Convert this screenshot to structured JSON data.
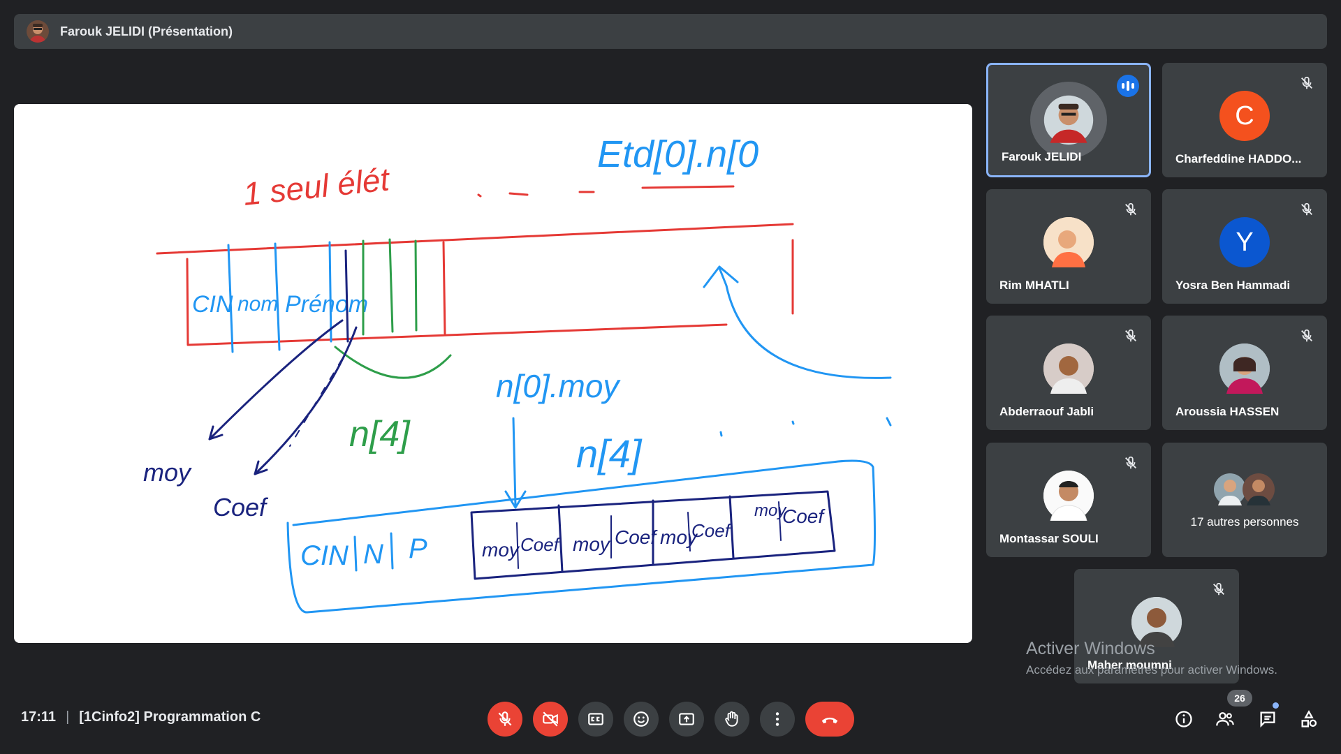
{
  "presenter_bar": {
    "title": "Farouk JELIDI (Présentation)"
  },
  "whiteboard": {
    "texts": [
      "1 seul élét",
      "Etd[0].n[0",
      "CIN",
      "nom",
      "Prénom",
      "n[0].moy",
      "n[4]",
      "n[4]",
      "moy",
      "Coef",
      "CIN",
      "N",
      "P",
      "moy",
      "Coef",
      "moy",
      "Coef",
      "moy",
      "Coef",
      "moy",
      "Coef"
    ]
  },
  "participants": [
    {
      "name": "Farouk JELIDI",
      "avatar": "photo-farouk",
      "speaking": true
    },
    {
      "name": "Charfeddine HADDO...",
      "initial": "C",
      "avatar_color": "#f4511e",
      "muted": true
    },
    {
      "name": "Rim MHATLI",
      "avatar": "photo-rim",
      "muted": true
    },
    {
      "name": "Yosra Ben Hammadi",
      "initial": "Y",
      "avatar_color": "#0b57d0",
      "muted": true
    },
    {
      "name": "Abderraouf Jabli",
      "avatar": "photo-abderraouf",
      "muted": true
    },
    {
      "name": "Aroussia HASSEN",
      "avatar": "photo-aroussia",
      "muted": true
    },
    {
      "name": "Montassar SOULI",
      "avatar": "photo-montassar",
      "muted": true
    },
    {
      "name": "17 autres personnes",
      "avatar": "group-photos"
    },
    {
      "name": "Maher moumni",
      "avatar": "photo-maher",
      "muted": true
    }
  ],
  "watermark": {
    "line1": "Activer Windows",
    "line2": "Accédez aux paramètres pour activer Windows."
  },
  "meeting": {
    "time": "17:11",
    "separator": "|",
    "name": "[1Cinfo2] Programmation C"
  },
  "controls": [
    "mic-off-icon",
    "camera-off-icon",
    "captions-icon",
    "emoji-icon",
    "present-icon",
    "raise-hand-icon",
    "more-options-icon",
    "end-call-icon"
  ],
  "right_controls": {
    "participants_count": "26",
    "icons": [
      "info-icon",
      "people-icon",
      "chat-icon",
      "activities-icon"
    ]
  },
  "colors": {
    "background": "#202124",
    "tile": "#3c4043",
    "red": "#ea4335",
    "accent": "#8ab4f8",
    "active_blue": "#1a73e8"
  }
}
